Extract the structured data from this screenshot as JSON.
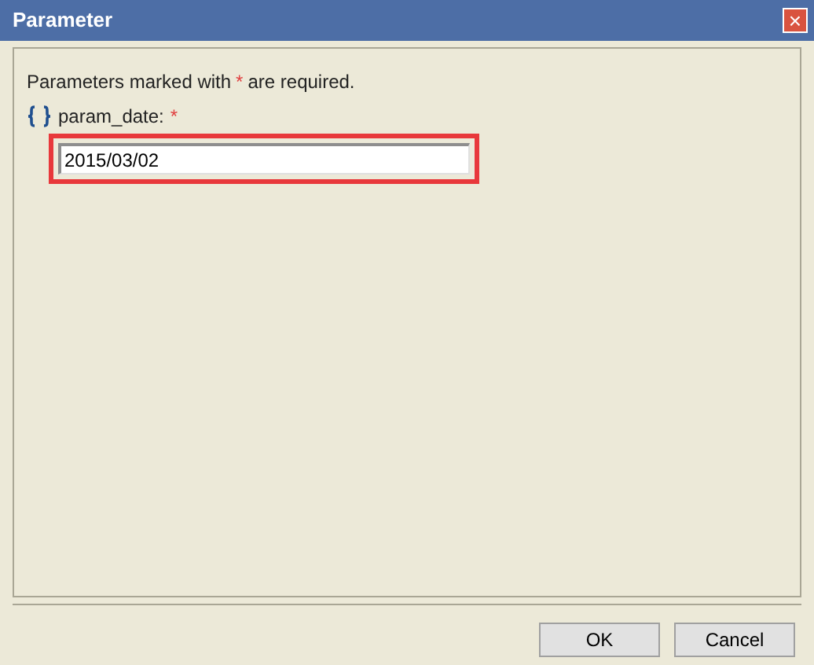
{
  "window": {
    "title": "Parameter",
    "close_label": "×"
  },
  "note": {
    "before": "Parameters marked with",
    "mark": "*",
    "after": "are required."
  },
  "parameters": [
    {
      "label": "param_date:",
      "required_mark": "*",
      "value": "2015/03/02",
      "highlighted": true
    }
  ],
  "buttons": [
    {
      "label": "OK"
    },
    {
      "label": "Cancel"
    }
  ]
}
